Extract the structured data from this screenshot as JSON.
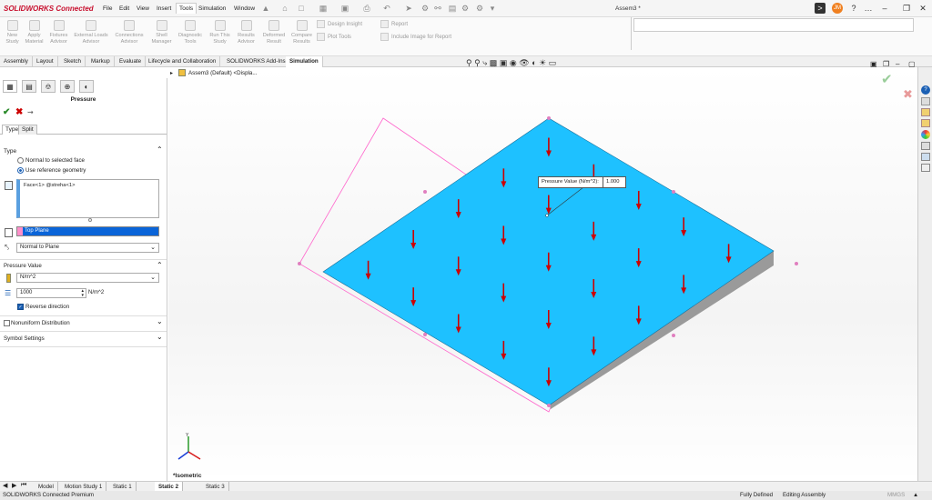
{
  "app": {
    "logo": "SOLIDWORKS Connected",
    "window_title": "Assem3 *",
    "avatar": "JM"
  },
  "menus": [
    "File",
    "Edit",
    "View",
    "Insert",
    "Tools",
    "Simulation",
    "Window"
  ],
  "ribbon": {
    "buttons": [
      {
        "label": "New Study",
        "icon": "new-study-icon"
      },
      {
        "label": "Apply Material",
        "icon": "apply-material-icon"
      },
      {
        "label": "Fixtures Advisor",
        "icon": "fixtures-icon"
      },
      {
        "label": "External Loads Advisor",
        "icon": "external-loads-icon"
      },
      {
        "label": "Connections Advisor",
        "icon": "connections-icon"
      },
      {
        "label": "Shell Manager",
        "icon": "shell-manager-icon"
      },
      {
        "label": "Diagnostic Tools",
        "icon": "diagnostic-tools-icon"
      },
      {
        "label": "Run This Study",
        "icon": "run-study-icon"
      },
      {
        "label": "Results Advisor",
        "icon": "results-advisor-icon"
      },
      {
        "label": "Deformed Result",
        "icon": "deformed-result-icon"
      },
      {
        "label": "Compare Results",
        "icon": "compare-results-icon"
      }
    ],
    "small": {
      "design_insight": "Design Insight",
      "plot_tools": "Plot Tools",
      "report": "Report",
      "include_image": "Include Image for Report"
    }
  },
  "cmdtabs": [
    "Assembly",
    "Layout",
    "Sketch",
    "Markup",
    "Evaluate",
    "Lifecycle and Collaboration",
    "SOLIDWORKS Add-Ins",
    "Simulation"
  ],
  "tree": {
    "root": "Assem3 (Default) <Displa..."
  },
  "panel": {
    "title": "Pressure",
    "tabs": [
      "Type",
      "Split"
    ],
    "type_section": "Type",
    "radio_normal": "Normal to selected face",
    "radio_ref": "Use reference geometry",
    "faces": "Face<1> @streha<1>",
    "ref_plane": "Top Plane",
    "direction": "Normal to Plane",
    "pressure_section": "Pressure Value",
    "unit": "N/m^2",
    "value": "1000",
    "value_unit": "N/m^2",
    "reverse": "Reverse direction",
    "nonuniform": "Nonuniform Distribution",
    "symbol": "Symbol Settings"
  },
  "viewport": {
    "callout_label": "Pressure Value (N/m^2):",
    "callout_value": "1.000",
    "view_label": "*Isometric",
    "triad_y": "Y"
  },
  "bottom_tabs": [
    "Model",
    "Motion Study 1",
    "Static 1",
    "Static 2",
    "Static 3"
  ],
  "status": {
    "left": "SOLIDWORKS Connected Premium",
    "fully": "Fully Defined",
    "editing": "Editing Assembly",
    "units": "MMGS"
  },
  "colors": {
    "plate": "#1ec1ff",
    "arrow": "#cc0000",
    "edge": "#ff66cc",
    "accent": "#c8102e"
  }
}
